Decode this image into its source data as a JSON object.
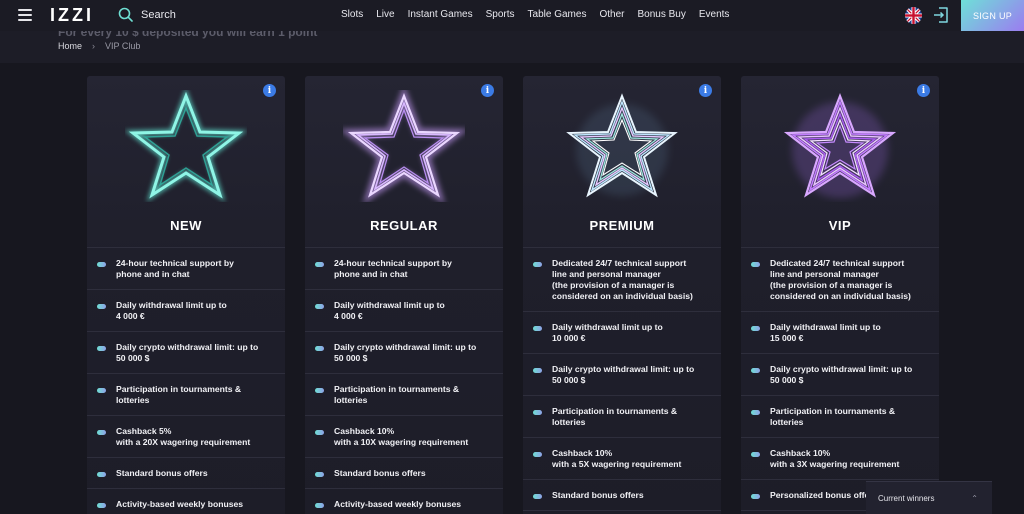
{
  "header": {
    "logo": "IZZI",
    "search_label": "Search",
    "nav": [
      "Slots",
      "Live",
      "Instant Games",
      "Sports",
      "Table Games",
      "Other",
      "Bonus Buy",
      "Events"
    ],
    "signup_label": "SIGN UP"
  },
  "subheader": {
    "cut_text": "For every 10 $ deposited you will earn 1 point",
    "breadcrumb": {
      "home": "Home",
      "separator": "›",
      "current": "VIP Club"
    }
  },
  "colors": {
    "background": "#17171f",
    "card": "#22222f",
    "accent_teal": "#6fdfd3",
    "accent_purple": "#b98cf2",
    "info_blue": "#3b7be5"
  },
  "cards": [
    {
      "name": "NEW",
      "star_icon": "teal-star-icon",
      "features": [
        [
          "24-hour technical support by",
          "phone and in chat"
        ],
        [
          "Daily withdrawal limit up to",
          "4 000 €"
        ],
        [
          "Daily crypto withdrawal limit: up to",
          "50 000 $"
        ],
        [
          "Participation in tournaments &",
          "lotteries"
        ],
        [
          "Cashback 5%",
          "with a 20X wagering requirement"
        ],
        [
          "Standard bonus offers"
        ],
        [
          "Activity-based weekly bonuses"
        ]
      ]
    },
    {
      "name": "REGULAR",
      "star_icon": "lilac-star-icon",
      "features": [
        [
          "24-hour technical support by",
          "phone and in chat"
        ],
        [
          "Daily withdrawal limit up to",
          "4 000 €"
        ],
        [
          "Daily crypto withdrawal limit: up to",
          "50 000 $"
        ],
        [
          "Participation in tournaments &",
          "lotteries"
        ],
        [
          "Cashback 10%",
          "with a 10X wagering requirement"
        ],
        [
          "Standard bonus offers"
        ],
        [
          "Activity-based weekly bonuses"
        ]
      ]
    },
    {
      "name": "PREMIUM",
      "star_icon": "multi-star-icon",
      "features": [
        [
          "Dedicated 24/7 technical support",
          "line and personal manager",
          "(the provision of a manager is",
          "considered on an individual basis)"
        ],
        [
          "Daily withdrawal limit up to",
          "10 000 €"
        ],
        [
          "Daily crypto withdrawal limit: up to",
          "50 000 $"
        ],
        [
          "Participation in tournaments &",
          "lotteries"
        ],
        [
          "Cashback 10%",
          "with a 5X wagering requirement"
        ],
        [
          "Standard bonus offers"
        ]
      ]
    },
    {
      "name": "VIP",
      "star_icon": "purple-star-icon",
      "features": [
        [
          "Dedicated 24/7 technical support",
          "line and personal manager",
          "(the provision of a manager is",
          "considered on an individual basis)"
        ],
        [
          "Daily withdrawal limit up to",
          "15 000 €"
        ],
        [
          "Daily crypto withdrawal limit: up to",
          "50 000 $"
        ],
        [
          "Participation in tournaments &",
          "lotteries"
        ],
        [
          "Cashback 10%",
          "with a 3X wagering requirement"
        ],
        [
          "Personalized bonus offers"
        ]
      ]
    }
  ],
  "winners": {
    "label": "Current winners",
    "chevron": "⌃"
  }
}
